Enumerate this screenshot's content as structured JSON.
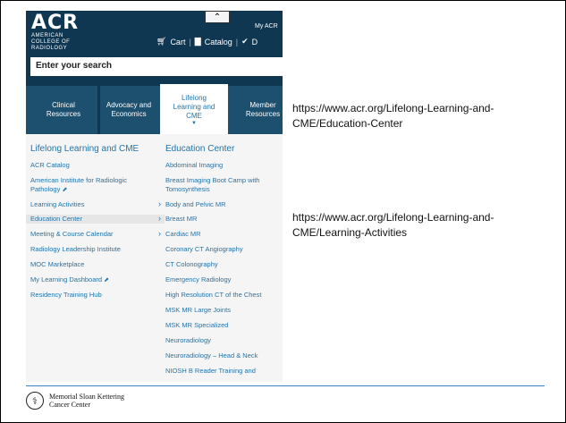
{
  "site": {
    "logo_main": "ACR",
    "logo_sub": "AMERICAN COLLEGE OF RADIOLOGY",
    "my_acr": "My ACR",
    "cart": "Cart",
    "catalog": "Catalog",
    "search_placeholder": "Enter your search"
  },
  "nav": {
    "tabs": [
      {
        "line1": "Clinical",
        "line2": "Resources",
        "line3": ""
      },
      {
        "line1": "Advocacy and",
        "line2": "Economics",
        "line3": ""
      },
      {
        "line1": "Lifelong",
        "line2": "Learning and",
        "line3": "CME"
      },
      {
        "line1": "Member",
        "line2": "Resources",
        "line3": ""
      }
    ]
  },
  "menu_left": {
    "heading": "Lifelong Learning and CME",
    "items": [
      "ACR Catalog",
      "American Institute for Radiologic",
      "Pathology",
      "Learning Activities",
      "Education Center",
      "Meeting & Course Calendar",
      "Radiology Leadership Institute",
      "MOC Marketplace",
      "My Learning Dashboard",
      "Residency Training Hub"
    ]
  },
  "menu_right": {
    "heading": "Education Center",
    "items": [
      "Abdominal Imaging",
      "Breast Imaging Boot Camp with",
      "Tomosynthesis",
      "Body and Pelvic MR",
      "Breast MR",
      "Cardiac MR",
      "Coronary CT Angiography",
      "CT Colonography",
      "Emergency Radiology",
      "High Resolution CT of the Chest",
      "MSK MR Large Joints",
      "MSK MR Specialized",
      "Neuroradiology",
      "Neuroradiology – Head & Neck",
      "NIOSH B Reader Training and"
    ]
  },
  "urls": {
    "education_center": "https://www.acr.org/Lifelong-Learning-and-CME/Education-Center",
    "learning_activities": "https://www.acr.org/Lifelong-Learning-and-CME/Learning-Activities"
  },
  "footer": {
    "org_line1": "Memorial Sloan Kettering",
    "org_line2": "Cancer Center"
  },
  "colors": {
    "header_navy": "#0f3752",
    "nav_blue": "#1d4f6e",
    "link_blue": "#2574a9",
    "rule_blue": "#3b7fc4"
  }
}
